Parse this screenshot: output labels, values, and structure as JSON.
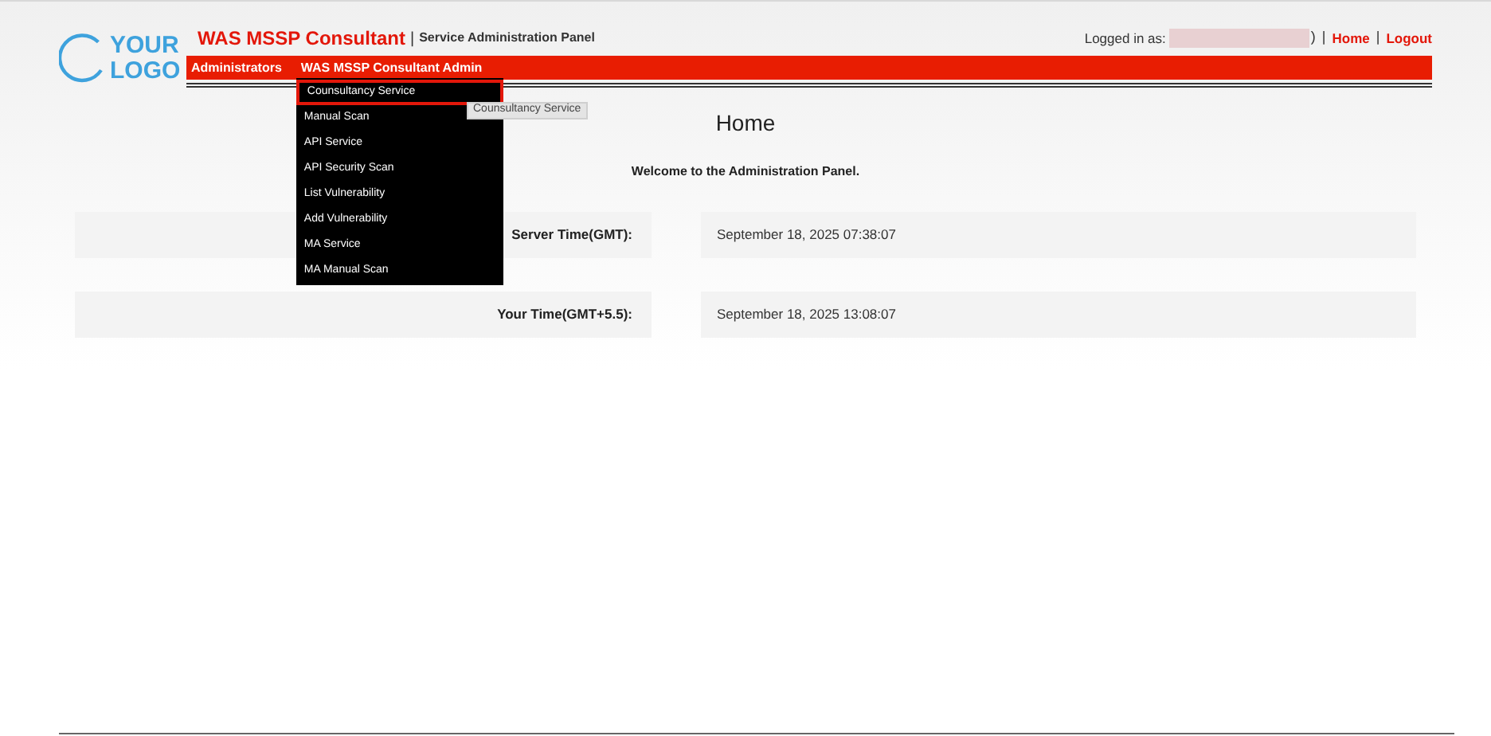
{
  "header": {
    "logo": [
      "YOUR",
      "LOGO"
    ],
    "app_name": "WAS MSSP Consultant",
    "separator": "|",
    "subtitle": "Service Administration Panel",
    "logged_in_label": "Logged in as:",
    "user_suffix": ")",
    "links": [
      {
        "label": "Home"
      },
      {
        "label": "Logout"
      }
    ],
    "link_separator": "|"
  },
  "nav": [
    {
      "label": "Administrators"
    },
    {
      "label": "WAS MSSP Consultant Admin",
      "menu": [
        {
          "label": "Counsultancy Service",
          "selected": true
        },
        {
          "label": "Manual Scan",
          "selected": false
        },
        {
          "label": "API Service",
          "selected": false
        },
        {
          "label": "API Security Scan",
          "selected": false
        },
        {
          "label": "List Vulnerability",
          "selected": false
        },
        {
          "label": "Add Vulnerability",
          "selected": false
        },
        {
          "label": "MA Service",
          "selected": false
        },
        {
          "label": "MA Manual Scan",
          "selected": false
        }
      ]
    }
  ],
  "tooltip": "Counsultancy Service",
  "page_title": "Home",
  "welcome": "Welcome to the Administration Panel.",
  "rows": [
    {
      "label": "Server Time(GMT):",
      "value": "September 18, 2025 07:38:07"
    },
    {
      "label": "Your Time(GMT+5.5):",
      "value": "September 18, 2025 13:08:07"
    }
  ]
}
